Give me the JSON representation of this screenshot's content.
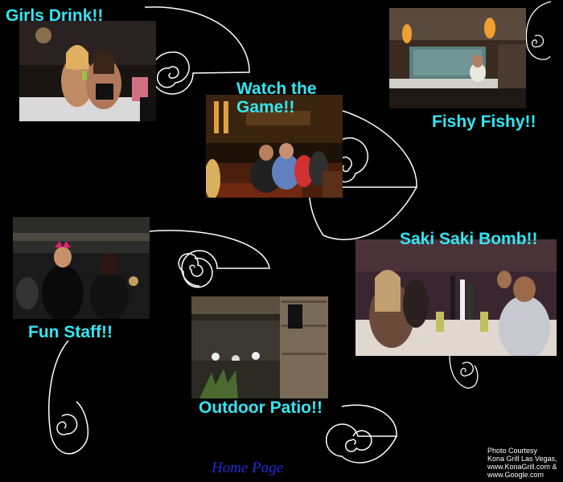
{
  "captions": {
    "girls": "Girls Drink!!",
    "game_line1": "Watch the",
    "game_line2": "Game!!",
    "fishy": "Fishy Fishy!!",
    "saki": "Saki Saki Bomb!!",
    "staff": "Fun Staff!!",
    "patio": "Outdoor Patio!!"
  },
  "home_link": "Home Page",
  "credit": {
    "line1": "Photo Courtesy",
    "line2": "Kona Grill Las Vegas,",
    "line3": "www.KonaGrill.com &",
    "line4": "www.Google.com"
  },
  "colors": {
    "caption": "#33e6f2",
    "link": "#1f2fd8",
    "background": "#000000"
  },
  "icons": [
    "nautilus-spiral-icon"
  ]
}
